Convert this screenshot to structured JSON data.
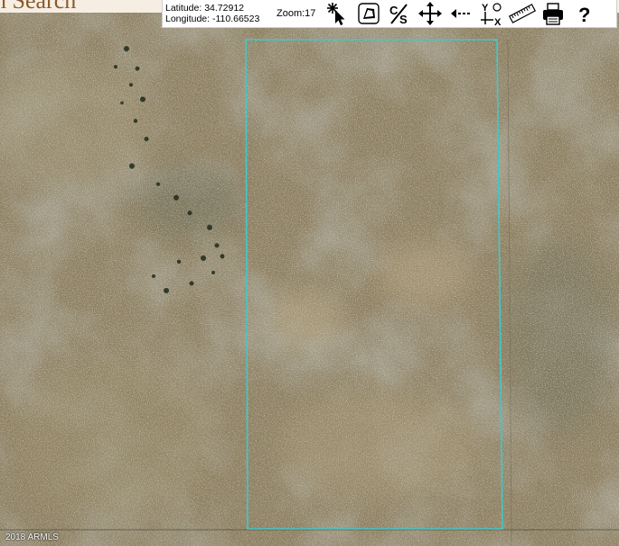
{
  "page": {
    "heading": "n Search"
  },
  "toolbar": {
    "latitude_label": "Latitude: 34.72912",
    "longitude_label": "Longitude: -110.66523",
    "zoom_label": "Zoom:17",
    "tools": [
      {
        "name": "identify-tool",
        "icon": "starburst-cursor-icon"
      },
      {
        "name": "polygon-tool",
        "icon": "polygon-select-icon"
      },
      {
        "name": "clear-selection-tool",
        "icon": "clear-selection-icon"
      },
      {
        "name": "pan-tool",
        "icon": "pan-arrows-icon"
      },
      {
        "name": "back-tool",
        "icon": "back-arrow-icon"
      },
      {
        "name": "coordinates-tool",
        "icon": "xy-coordinates-icon"
      },
      {
        "name": "measure-tool",
        "icon": "ruler-icon"
      },
      {
        "name": "print-tool",
        "icon": "printer-icon"
      },
      {
        "name": "help-tool",
        "icon": "question-mark-icon"
      }
    ]
  },
  "map": {
    "copyright": "2018 ARMLS",
    "parcel_outline_color": "#3fc9c9",
    "terrain_color": "#8a7f62"
  }
}
